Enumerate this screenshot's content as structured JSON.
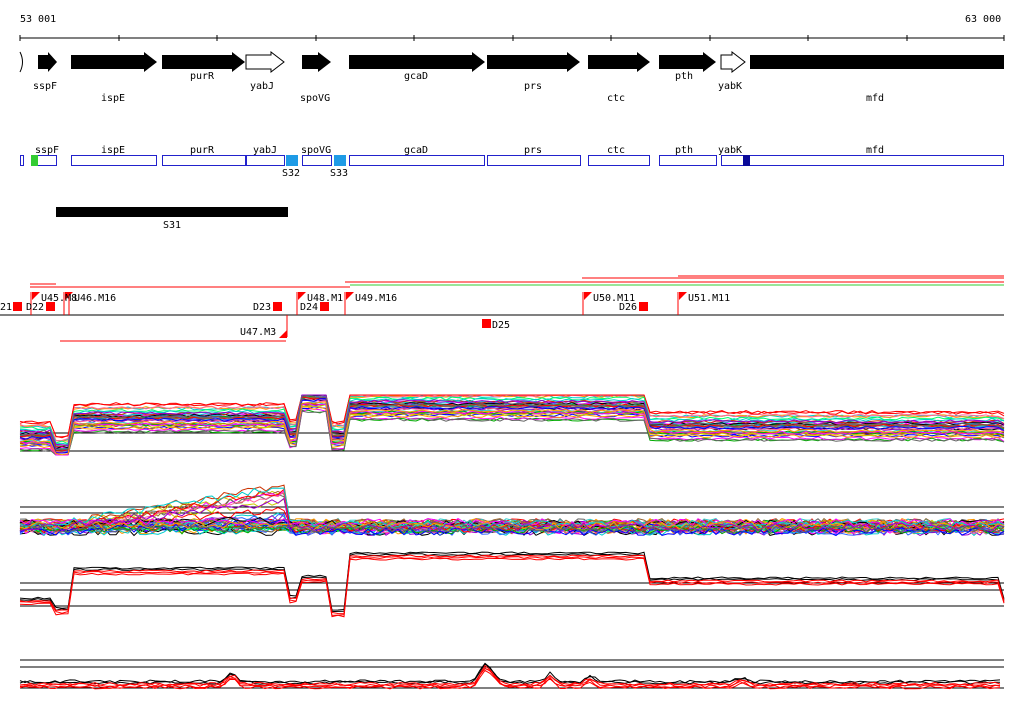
{
  "axis": {
    "start_label": "53 001",
    "end_label": "63 000",
    "start": 53001,
    "end": 63000
  },
  "genes": [
    {
      "name": "sspF",
      "strand": "+",
      "filled": true
    },
    {
      "name": "ispE",
      "strand": "+",
      "filled": true
    },
    {
      "name": "purR",
      "strand": "+",
      "filled": true
    },
    {
      "name": "yabJ",
      "strand": "+",
      "filled": false
    },
    {
      "name": "spoVG",
      "strand": "+",
      "filled": true
    },
    {
      "name": "gcaD",
      "strand": "+",
      "filled": true
    },
    {
      "name": "prs",
      "strand": "+",
      "filled": true
    },
    {
      "name": "ctc",
      "strand": "+",
      "filled": true
    },
    {
      "name": "pth",
      "strand": "+",
      "filled": true
    },
    {
      "name": "yabK",
      "strand": "+",
      "filled": false
    },
    {
      "name": "mfd",
      "strand": "+",
      "filled": true
    }
  ],
  "segment_labels": [
    {
      "label": "S31"
    },
    {
      "label": "S32",
      "color": "#1e9be6"
    },
    {
      "label": "S33",
      "color": "#1e9be6"
    }
  ],
  "features": {
    "upstream": [
      "U45.M8",
      "U46.M16",
      "U47.M3",
      "U48.M1",
      "U49.M16",
      "U50.M11",
      "U51.M11"
    ],
    "downstream": [
      "21",
      "D22",
      "D23",
      "D24",
      "D25",
      "D26"
    ]
  },
  "colors": {
    "gene_fill": "#000000",
    "gene_box_stroke": "#2222cc",
    "marker_red": "#ff0000",
    "marker_green": "#33cc33",
    "marker_cyan": "#1e9be6",
    "marker_navy": "#0a0a99"
  }
}
